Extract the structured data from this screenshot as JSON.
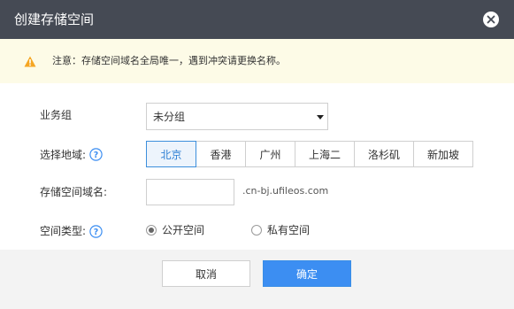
{
  "dialog": {
    "title": "创建存储空间"
  },
  "notice": {
    "text": "注意：存储空间域名全局唯一，遇到冲突请更换名称。"
  },
  "form": {
    "business_group": {
      "label": "业务组",
      "selected": "未分组"
    },
    "region": {
      "label": "选择地域:",
      "options": [
        "北京",
        "香港",
        "广州",
        "上海二",
        "洛杉矶",
        "新加坡"
      ],
      "selected": "北京"
    },
    "domain": {
      "label": "存储空间域名:",
      "value": "",
      "suffix": ".cn-bj.ufileos.com"
    },
    "space_type": {
      "label": "空间类型:",
      "options": [
        "公开空间",
        "私有空间"
      ],
      "selected": "公开空间"
    }
  },
  "footer": {
    "cancel_label": "取消",
    "confirm_label": "确定"
  },
  "icons": {
    "close": "close-icon",
    "warning": "warning-icon",
    "help": "question-icon"
  },
  "colors": {
    "header_bg": "#454a54",
    "notice_bg": "#fdfbe7",
    "accent": "#3c8ef2",
    "warning": "#f5a623"
  }
}
